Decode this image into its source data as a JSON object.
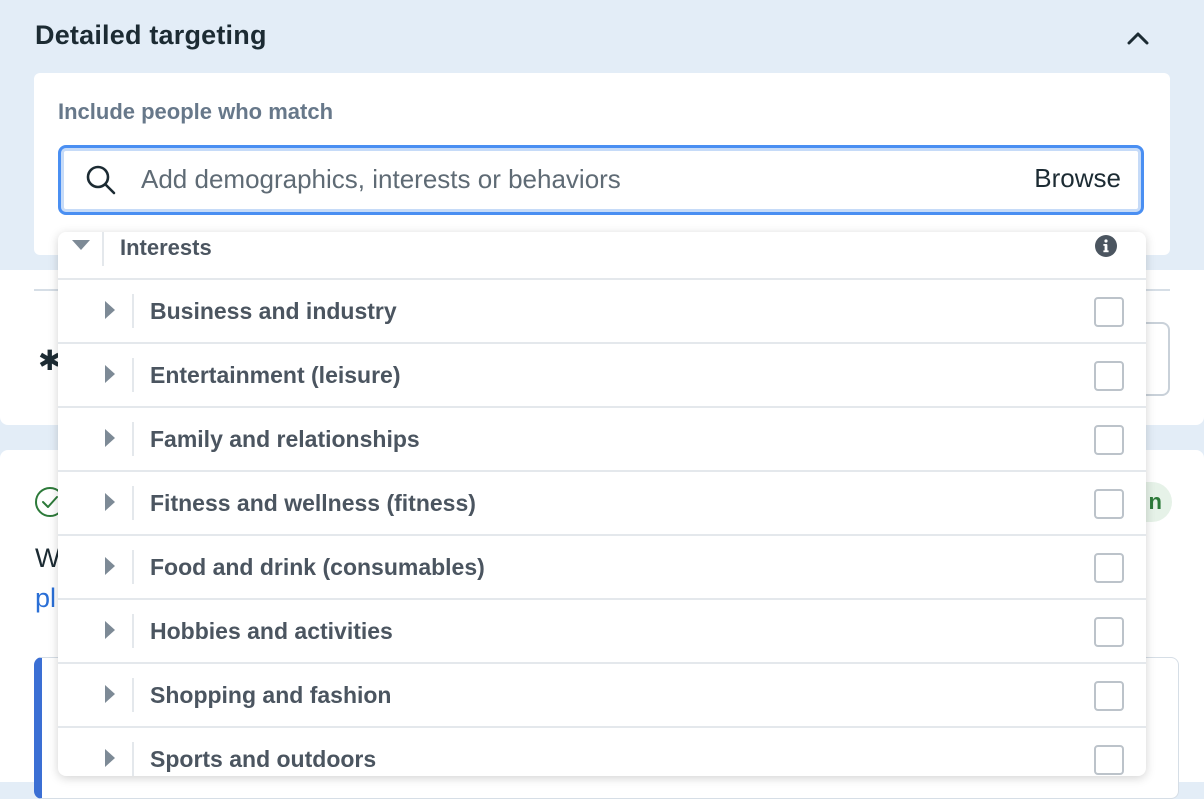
{
  "section": {
    "title": "Detailed targeting",
    "collapse_icon": "chevron-up-icon"
  },
  "include": {
    "label": "Include people who match"
  },
  "search": {
    "placeholder": "Add demographics, interests or behaviors",
    "value": "",
    "browse_label": "Browse",
    "icon": "search-icon"
  },
  "dropdown": {
    "header_label": "Interests",
    "header_icon": "info-icon",
    "items": [
      {
        "label": "Business and industry",
        "checked": false
      },
      {
        "label": "Entertainment (leisure)",
        "checked": false
      },
      {
        "label": "Family and relationships",
        "checked": false
      },
      {
        "label": "Fitness and wellness (fitness)",
        "checked": false
      },
      {
        "label": "Food and drink (consumables)",
        "checked": false
      },
      {
        "label": "Hobbies and activities",
        "checked": false
      },
      {
        "label": "Shopping and fashion",
        "checked": false
      },
      {
        "label": "Sports and outdoors",
        "checked": false
      }
    ]
  },
  "background": {
    "pill_text": "n",
    "text_line_1": "W",
    "text_line_2": "pl"
  },
  "colors": {
    "accent": "#4a8ff2",
    "panel_bg": "#e3edf7",
    "text_primary": "#1c2b33",
    "text_secondary": "#4b5560",
    "link": "#2a6fd6"
  }
}
